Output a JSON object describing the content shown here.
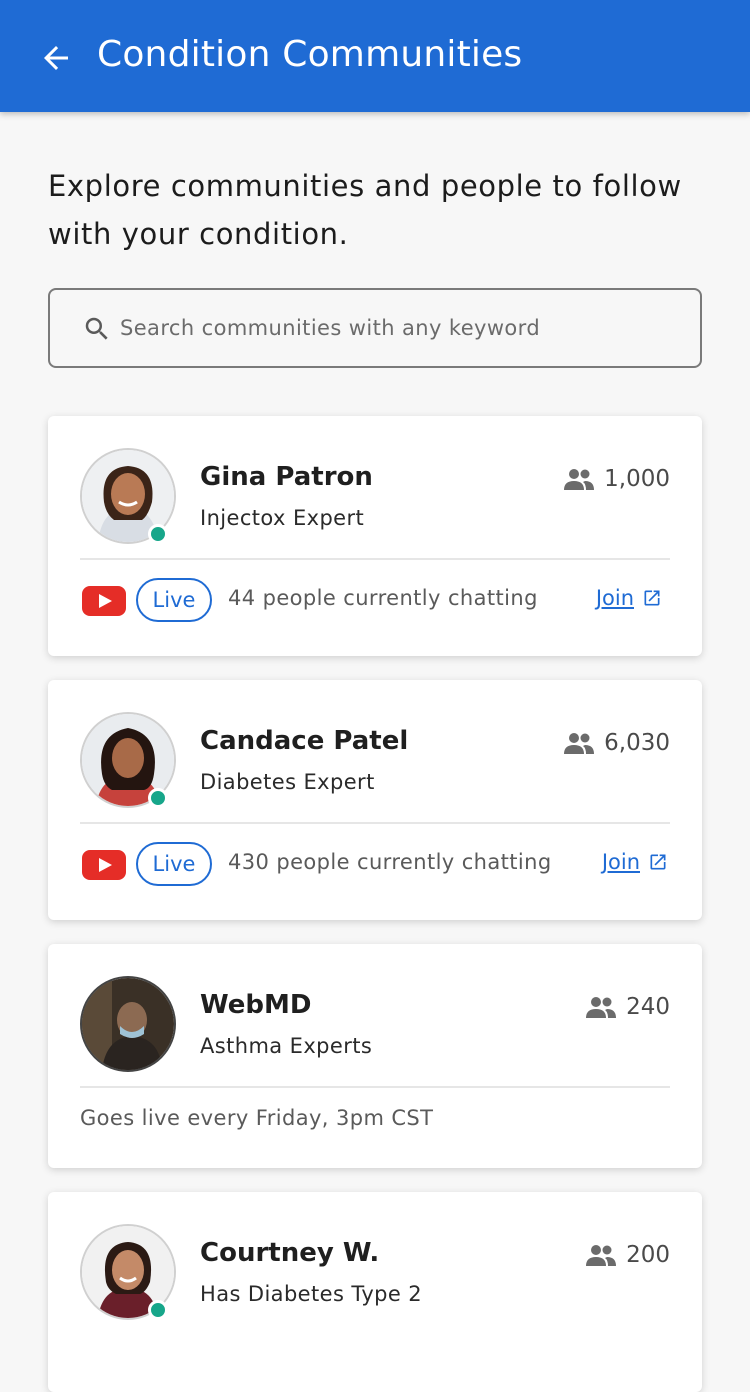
{
  "header": {
    "title": "Condition Communities",
    "background": "#1f6bd4"
  },
  "intro_text": "Explore communities and people to follow with your condition.",
  "search": {
    "placeholder": "Search communities with any keyword",
    "value": ""
  },
  "communities": [
    {
      "name": "Gina Patron",
      "role": "Injectox Expert",
      "members": "1,000",
      "online": true,
      "live": true,
      "live_label": "Live",
      "chatting": "44 people currently chatting",
      "join_label": "Join"
    },
    {
      "name": "Candace Patel",
      "role": "Diabetes Expert",
      "members": "6,030",
      "online": true,
      "live": true,
      "live_label": "Live",
      "chatting": "430 people currently chatting",
      "join_label": "Join"
    },
    {
      "name": "WebMD",
      "role": "Asthma Experts",
      "members": "240",
      "online": false,
      "live": false,
      "schedule": "Goes live every Friday, 3pm CST"
    },
    {
      "name": "Courtney W.",
      "role": "Has Diabetes Type 2",
      "members": "200",
      "online": true
    }
  ],
  "colors": {
    "accent": "#1f6bd4",
    "online": "#17a68a",
    "youtube": "#e52d27"
  }
}
